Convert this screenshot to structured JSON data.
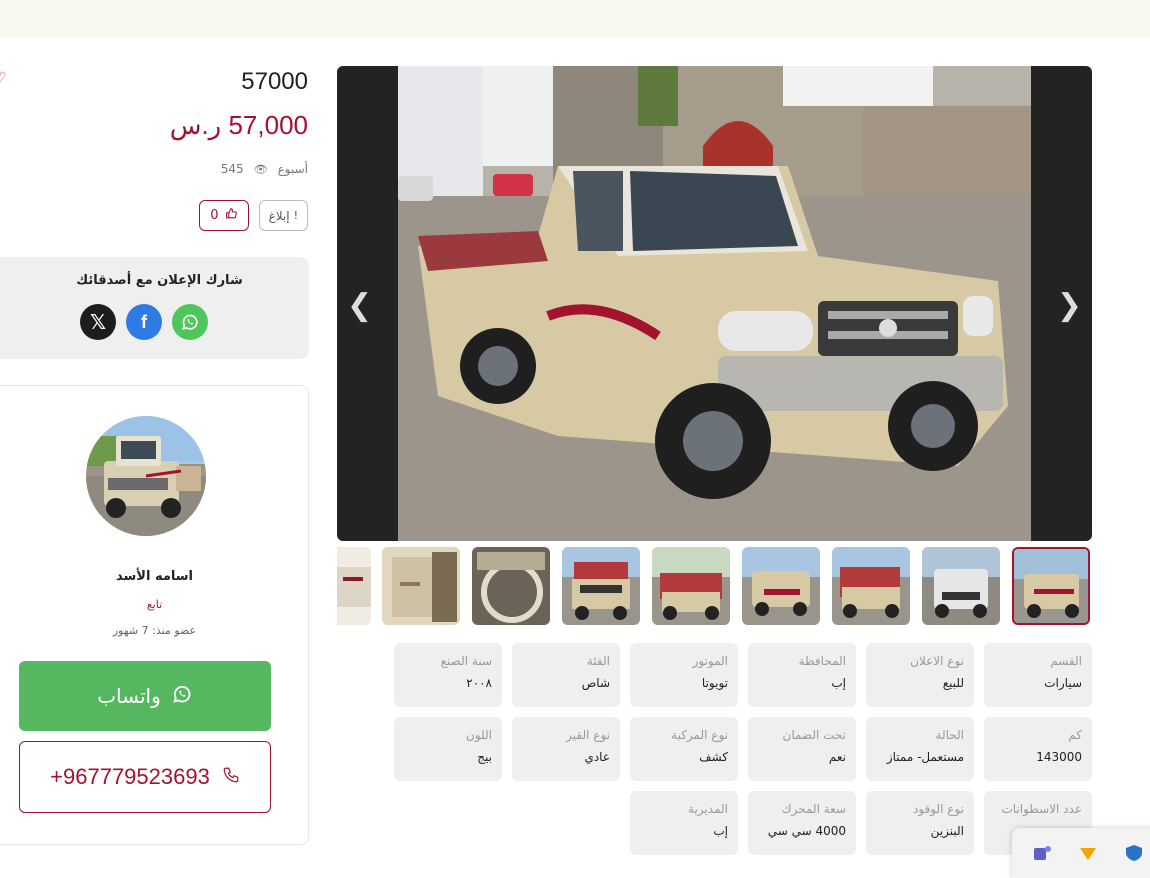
{
  "price": {
    "plain": "57000",
    "formatted": "57,000 ر.س"
  },
  "meta": {
    "posted": "أسبوع",
    "views": "545"
  },
  "actions": {
    "report_label": "إبلاغ",
    "likes": "0"
  },
  "share": {
    "title": "شارك الإعلان مع أصدقائك"
  },
  "seller": {
    "name": "اسامه الأسد",
    "role": "تابع",
    "member_since": "عضو منذ: 7 شهور"
  },
  "contact": {
    "whatsapp_label": "واتساب",
    "phone": "+967779523693"
  },
  "gallery": {
    "active_index": 0,
    "thumb_count": 10
  },
  "specs": [
    {
      "label": "القسم",
      "value": "سيارات"
    },
    {
      "label": "نوع الاعلان",
      "value": "للبيع"
    },
    {
      "label": "المحافظة",
      "value": "إب"
    },
    {
      "label": "الموتور",
      "value": "تويوتا"
    },
    {
      "label": "الفئة",
      "value": "شاص"
    },
    {
      "label": "سنة الصنع",
      "value": "٢٠٠٨"
    },
    {
      "label": "كم",
      "value": "143000"
    },
    {
      "label": "الحالة",
      "value": "مستعمل- ممتاز"
    },
    {
      "label": "تحت الضمان",
      "value": "نعم"
    },
    {
      "label": "نوع المركبة",
      "value": "كشف"
    },
    {
      "label": "نوع القير",
      "value": "عادي"
    },
    {
      "label": "اللون",
      "value": "بيج"
    },
    {
      "label": "عدد الاسطوانات",
      "value": ""
    },
    {
      "label": "نوع الوقود",
      "value": "البنزين"
    },
    {
      "label": "سعة المحرك",
      "value": "4000 سي سي"
    },
    {
      "label": "المديرية",
      "value": "إب"
    }
  ],
  "colors": {
    "brand": "#a3122f",
    "whatsapp": "#55b760",
    "facebook": "#2f7ae5"
  }
}
